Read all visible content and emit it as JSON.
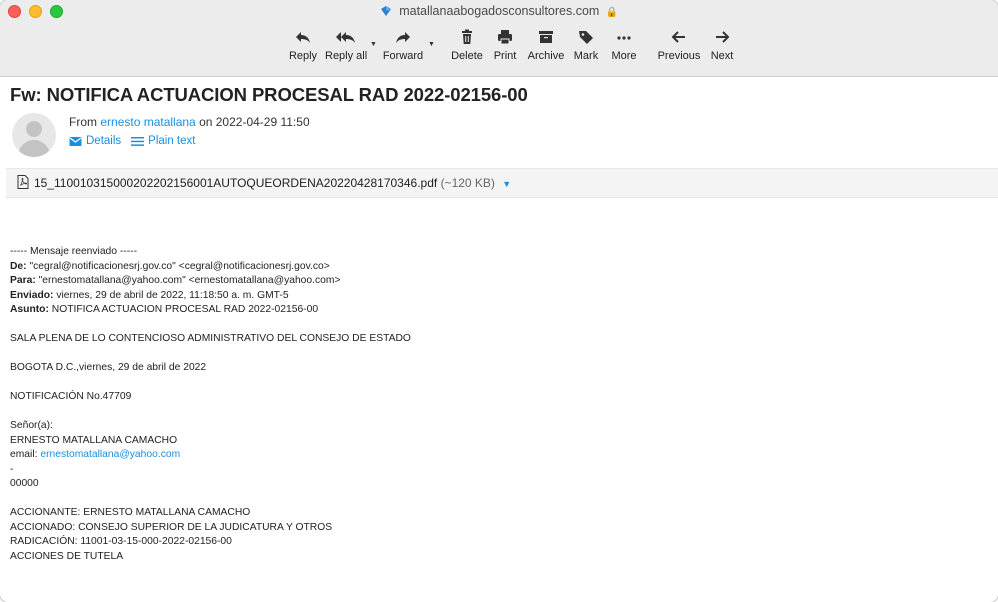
{
  "window": {
    "title": "matallanaabogadosconsultores.com"
  },
  "toolbar": {
    "reply": "Reply",
    "reply_all": "Reply all",
    "forward": "Forward",
    "delete": "Delete",
    "print": "Print",
    "archive": "Archive",
    "mark": "Mark",
    "more": "More",
    "previous": "Previous",
    "next": "Next"
  },
  "message": {
    "subject": "Fw: NOTIFICA ACTUACION PROCESAL RAD 2022-02156-00",
    "from_prefix": "From",
    "from_name": "ernesto matallana",
    "from_on": "on 2022-04-29 11:50",
    "details_label": "Details",
    "plaintext_label": "Plain text",
    "attachment": {
      "name": "15_110010315000202202156001AUTOQUEORDENA20220428170346.pdf",
      "size": "(~120 KB)"
    }
  },
  "body": {
    "forward_header": "----- Mensaje reenviado -----",
    "de_label": "De:",
    "de_value": "\"cegral@notificacionesrj.gov.co\" <cegral@notificacionesrj.gov.co>",
    "para_label": "Para:",
    "para_value": "\"ernestomatallana@yahoo.com\" <ernestomatallana@yahoo.com>",
    "enviado_label": "Enviado:",
    "enviado_value": "viernes, 29 de abril de 2022, 11:18:50 a. m. GMT-5",
    "asunto_label": "Asunto:",
    "asunto_value": "NOTIFICA ACTUACION PROCESAL RAD 2022-02156-00",
    "sala": "SALA PLENA DE LO CONTENCIOSO ADMINISTRATIVO DEL CONSEJO DE ESTADO",
    "bogota": "BOGOTA D.C.,viernes, 29 de abril de 2022",
    "notificacion": "NOTIFICACIÓN No.47709",
    "senor": "Señor(a):",
    "nombre": "ERNESTO MATALLANA CAMACHO",
    "email_label": "email:",
    "email_value": "ernestomatallana@yahoo.com",
    "dash": "-",
    "zeros": "00000",
    "accionante": "ACCIONANTE: ERNESTO MATALLANA CAMACHO",
    "accionado": "ACCIONADO: CONSEJO SUPERIOR DE LA JUDICATURA Y OTROS",
    "radicacion": "RADICACIÓN: 11001-03-15-000-2022-02156-00",
    "acciones": "ACCIONES DE TUTELA"
  }
}
